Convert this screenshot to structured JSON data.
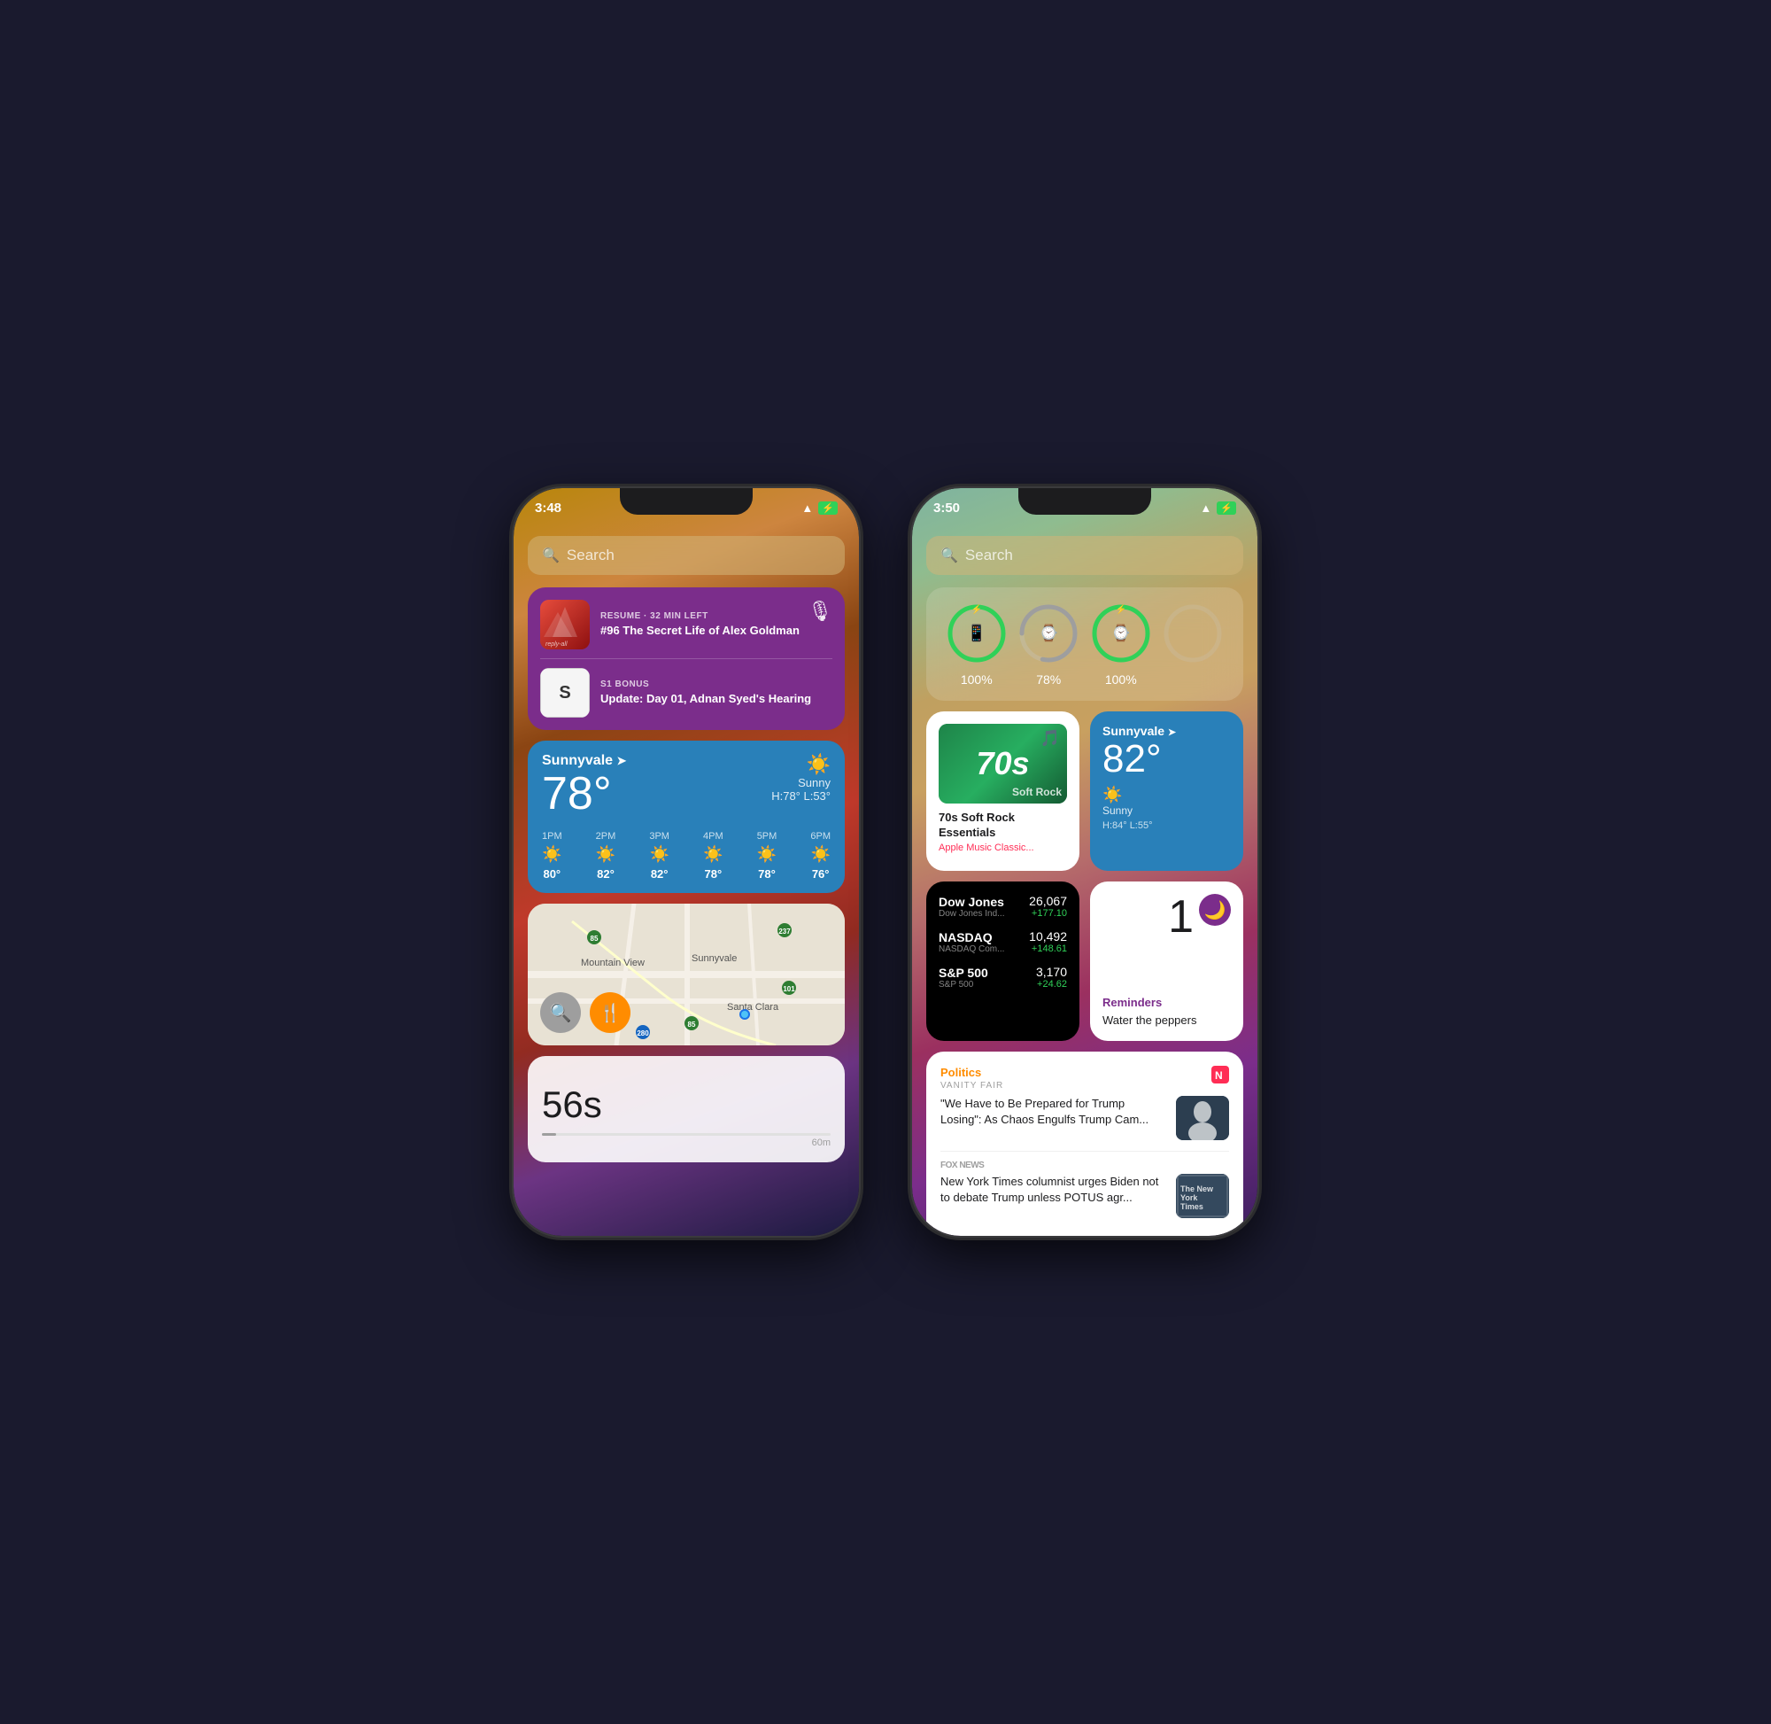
{
  "phone1": {
    "time": "3:48",
    "search": "Search",
    "podcast": {
      "item1": {
        "meta": "RESUME · 32 MIN LEFT",
        "title": "#96 The Secret Life of Alex Goldman"
      },
      "item2": {
        "meta": "S1 BONUS",
        "title": "Update: Day 01, Adnan Syed's Hearing"
      }
    },
    "weather": {
      "location": "Sunnyvale",
      "temp": "78°",
      "condition": "Sunny",
      "hi_lo": "H:78° L:53°",
      "forecast": [
        {
          "time": "1PM",
          "temp": "80°"
        },
        {
          "time": "2PM",
          "temp": "82°"
        },
        {
          "time": "3PM",
          "temp": "82°"
        },
        {
          "time": "4PM",
          "temp": "78°"
        },
        {
          "time": "5PM",
          "temp": "78°"
        },
        {
          "time": "6PM",
          "temp": "76°"
        }
      ]
    },
    "maps": {
      "labels": [
        "Mountain View",
        "Sunnyvale",
        "Santa Clara"
      ]
    },
    "screenrecord": {
      "time": "56s",
      "end_label": "60m"
    }
  },
  "phone2": {
    "time": "3:50",
    "search": "Search",
    "battery": {
      "items": [
        {
          "label": "100%",
          "value": 100,
          "color": "#30d158"
        },
        {
          "label": "78%",
          "value": 78,
          "color": "#9e9e9e"
        },
        {
          "label": "100%",
          "value": 100,
          "color": "#30d158"
        },
        {
          "label": "",
          "value": 0,
          "color": "transparent"
        }
      ]
    },
    "music": {
      "title": "70s Soft Rock Essentials",
      "source": "Apple Music Classic...",
      "art_text": "70s",
      "art_sub": "s"
    },
    "weather": {
      "location": "Sunnyvale",
      "temp": "82°",
      "condition": "Sunny",
      "hi_lo": "H:84° L:55°"
    },
    "stocks": [
      {
        "name": "Dow Jones",
        "full": "Dow Jones Ind...",
        "price": "26,067",
        "change": "+177.10"
      },
      {
        "name": "NASDAQ",
        "full": "NASDAQ Com...",
        "price": "10,492",
        "change": "+148.61"
      },
      {
        "name": "S&P 500",
        "full": "S&P 500",
        "price": "3,170",
        "change": "+24.62"
      }
    ],
    "reminders": {
      "count": "1",
      "app": "Reminders",
      "task": "Water the peppers"
    },
    "news": {
      "section": "Politics",
      "source1": "Vanity Fair",
      "headline1": "\"We Have to Be Prepared for Trump Losing\": As Chaos Engulfs Trump Cam...",
      "source2": "Fox News",
      "headline2": "New York Times columnist urges Biden not to debate Trump unless POTUS agr..."
    }
  }
}
